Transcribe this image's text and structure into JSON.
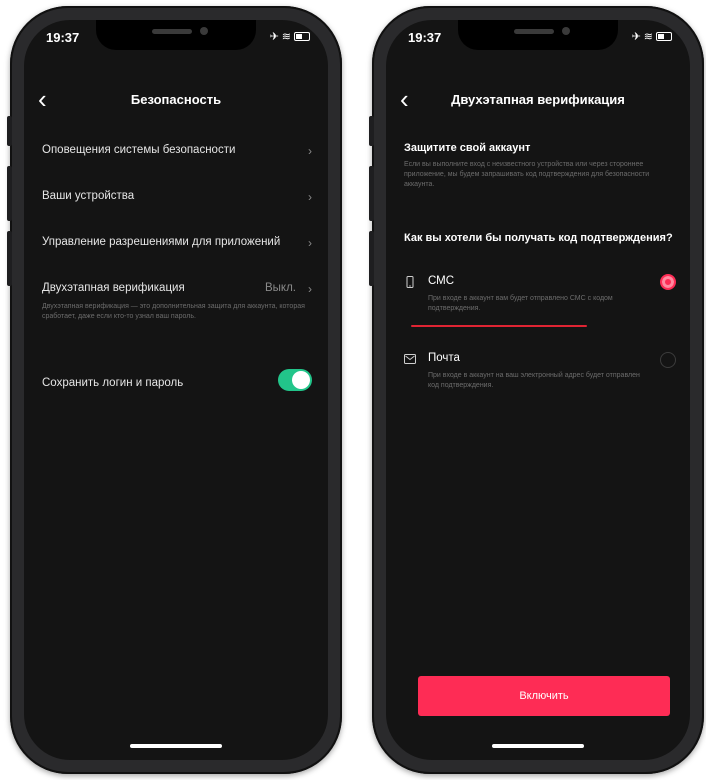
{
  "status_bar": {
    "time": "19:37"
  },
  "left_screen": {
    "title": "Безопасность",
    "items": [
      {
        "label": "Оповещения системы безопасности"
      },
      {
        "label": "Ваши устройства"
      },
      {
        "label": "Управление разрешениями для приложений"
      },
      {
        "label": "Двухэтапная верификация",
        "value": "Выкл.",
        "description": "Двухэтапная верификация — это дополнительная защита для аккаунта, которая сработает, даже если кто-то узнал ваш пароль."
      },
      {
        "label": "Сохранить логин и пароль",
        "toggle_on": true
      }
    ]
  },
  "right_screen": {
    "title": "Двухэтапная верификация",
    "protect_title": "Защитите свой аккаунт",
    "protect_desc": "Если вы выполните вход с неизвестного устройства или через стороннее приложение, мы будем запрашивать код подтверждения для безопасности аккаунта.",
    "question": "Как вы хотели бы получать код подтверждения?",
    "options": [
      {
        "label": "СМС",
        "icon": "phone-icon",
        "desc": "При входе в аккаунт вам будет отправлено СМС с кодом подтверждения.",
        "selected": true
      },
      {
        "label": "Почта",
        "icon": "mail-icon",
        "desc": "При входе в аккаунт на ваш электронный адрес будет отправлен код подтверждения.",
        "selected": false
      }
    ],
    "button_label": "Включить"
  },
  "colors": {
    "accent": "#fe2c55",
    "toggle": "#22c58a",
    "underline": "#e02433",
    "screen_bg": "#141414"
  }
}
